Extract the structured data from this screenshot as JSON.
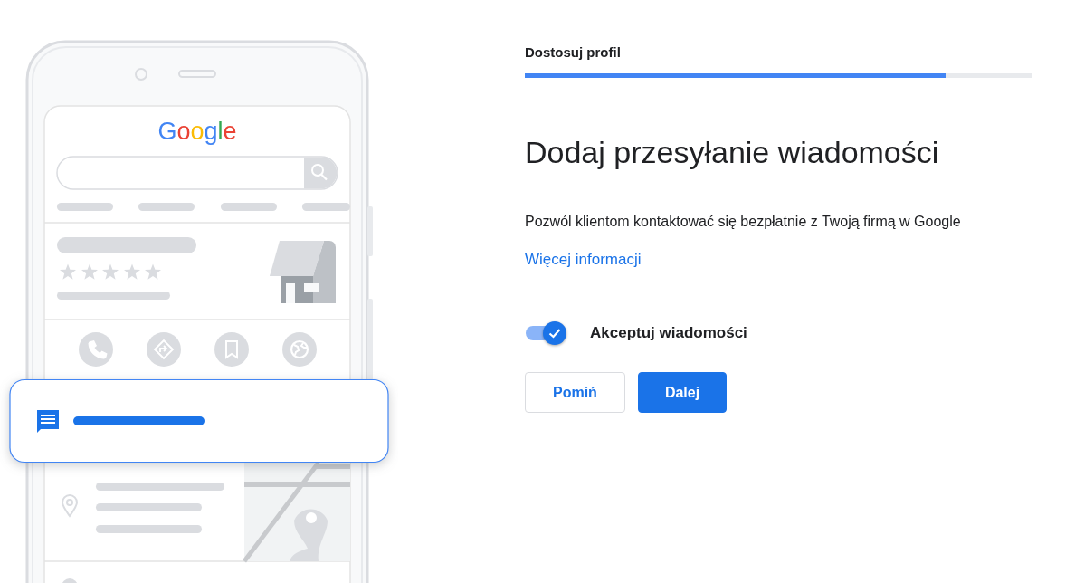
{
  "illustration": {
    "logo": "Google"
  },
  "header": {
    "step": "Dostosuj profil",
    "progress": {
      "level": 0.83
    }
  },
  "title": "Dodaj przesyłanie wiadomości",
  "description": "Pozwól klientom kontaktować się bezpłatnie z Twoją firmą w Google",
  "link": "Więcej informacji",
  "toggle": {
    "label": "Akceptuj wiadomości",
    "on": true
  },
  "buttons": [
    {
      "label": "Pomiń",
      "kind": "secondary"
    },
    {
      "label": "Dalej",
      "kind": "primary"
    }
  ]
}
